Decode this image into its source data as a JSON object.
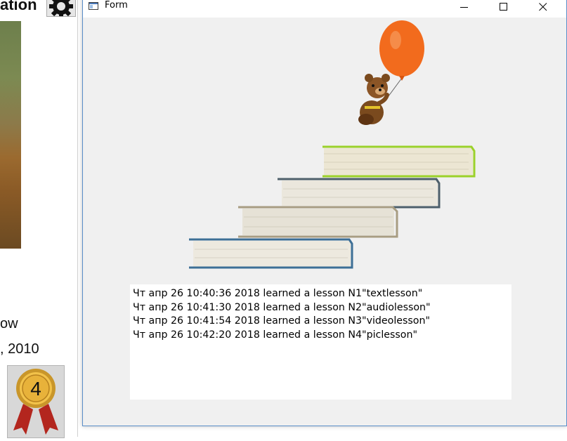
{
  "background_page": {
    "title_fragment": "ation",
    "line1": "ow",
    "line2": ", 2010",
    "badge_number": "4",
    "icons": [
      "gear-icon",
      "award-medal-icon"
    ]
  },
  "window": {
    "title": "Form",
    "controls": [
      "minimize-icon",
      "maximize-icon",
      "close-icon"
    ]
  },
  "scene": {
    "images": [
      "teddy-bear-with-balloon",
      "stacked-books-stairs"
    ],
    "colors": {
      "balloon": "#f26b1d",
      "top_book_cover": "#9bd12a",
      "bottom_book_cover": "#3d6f96"
    }
  },
  "log": {
    "lines": [
      "Чт апр 26 10:40:36 2018 learned a lesson N1\"textlesson\"",
      "Чт апр 26 10:41:30 2018 learned a lesson N2\"audiolesson\"",
      "Чт апр 26 10:41:54 2018 learned a lesson N3\"videolesson\"",
      "Чт апр 26 10:42:20 2018 learned a lesson N4\"piclesson\""
    ]
  }
}
